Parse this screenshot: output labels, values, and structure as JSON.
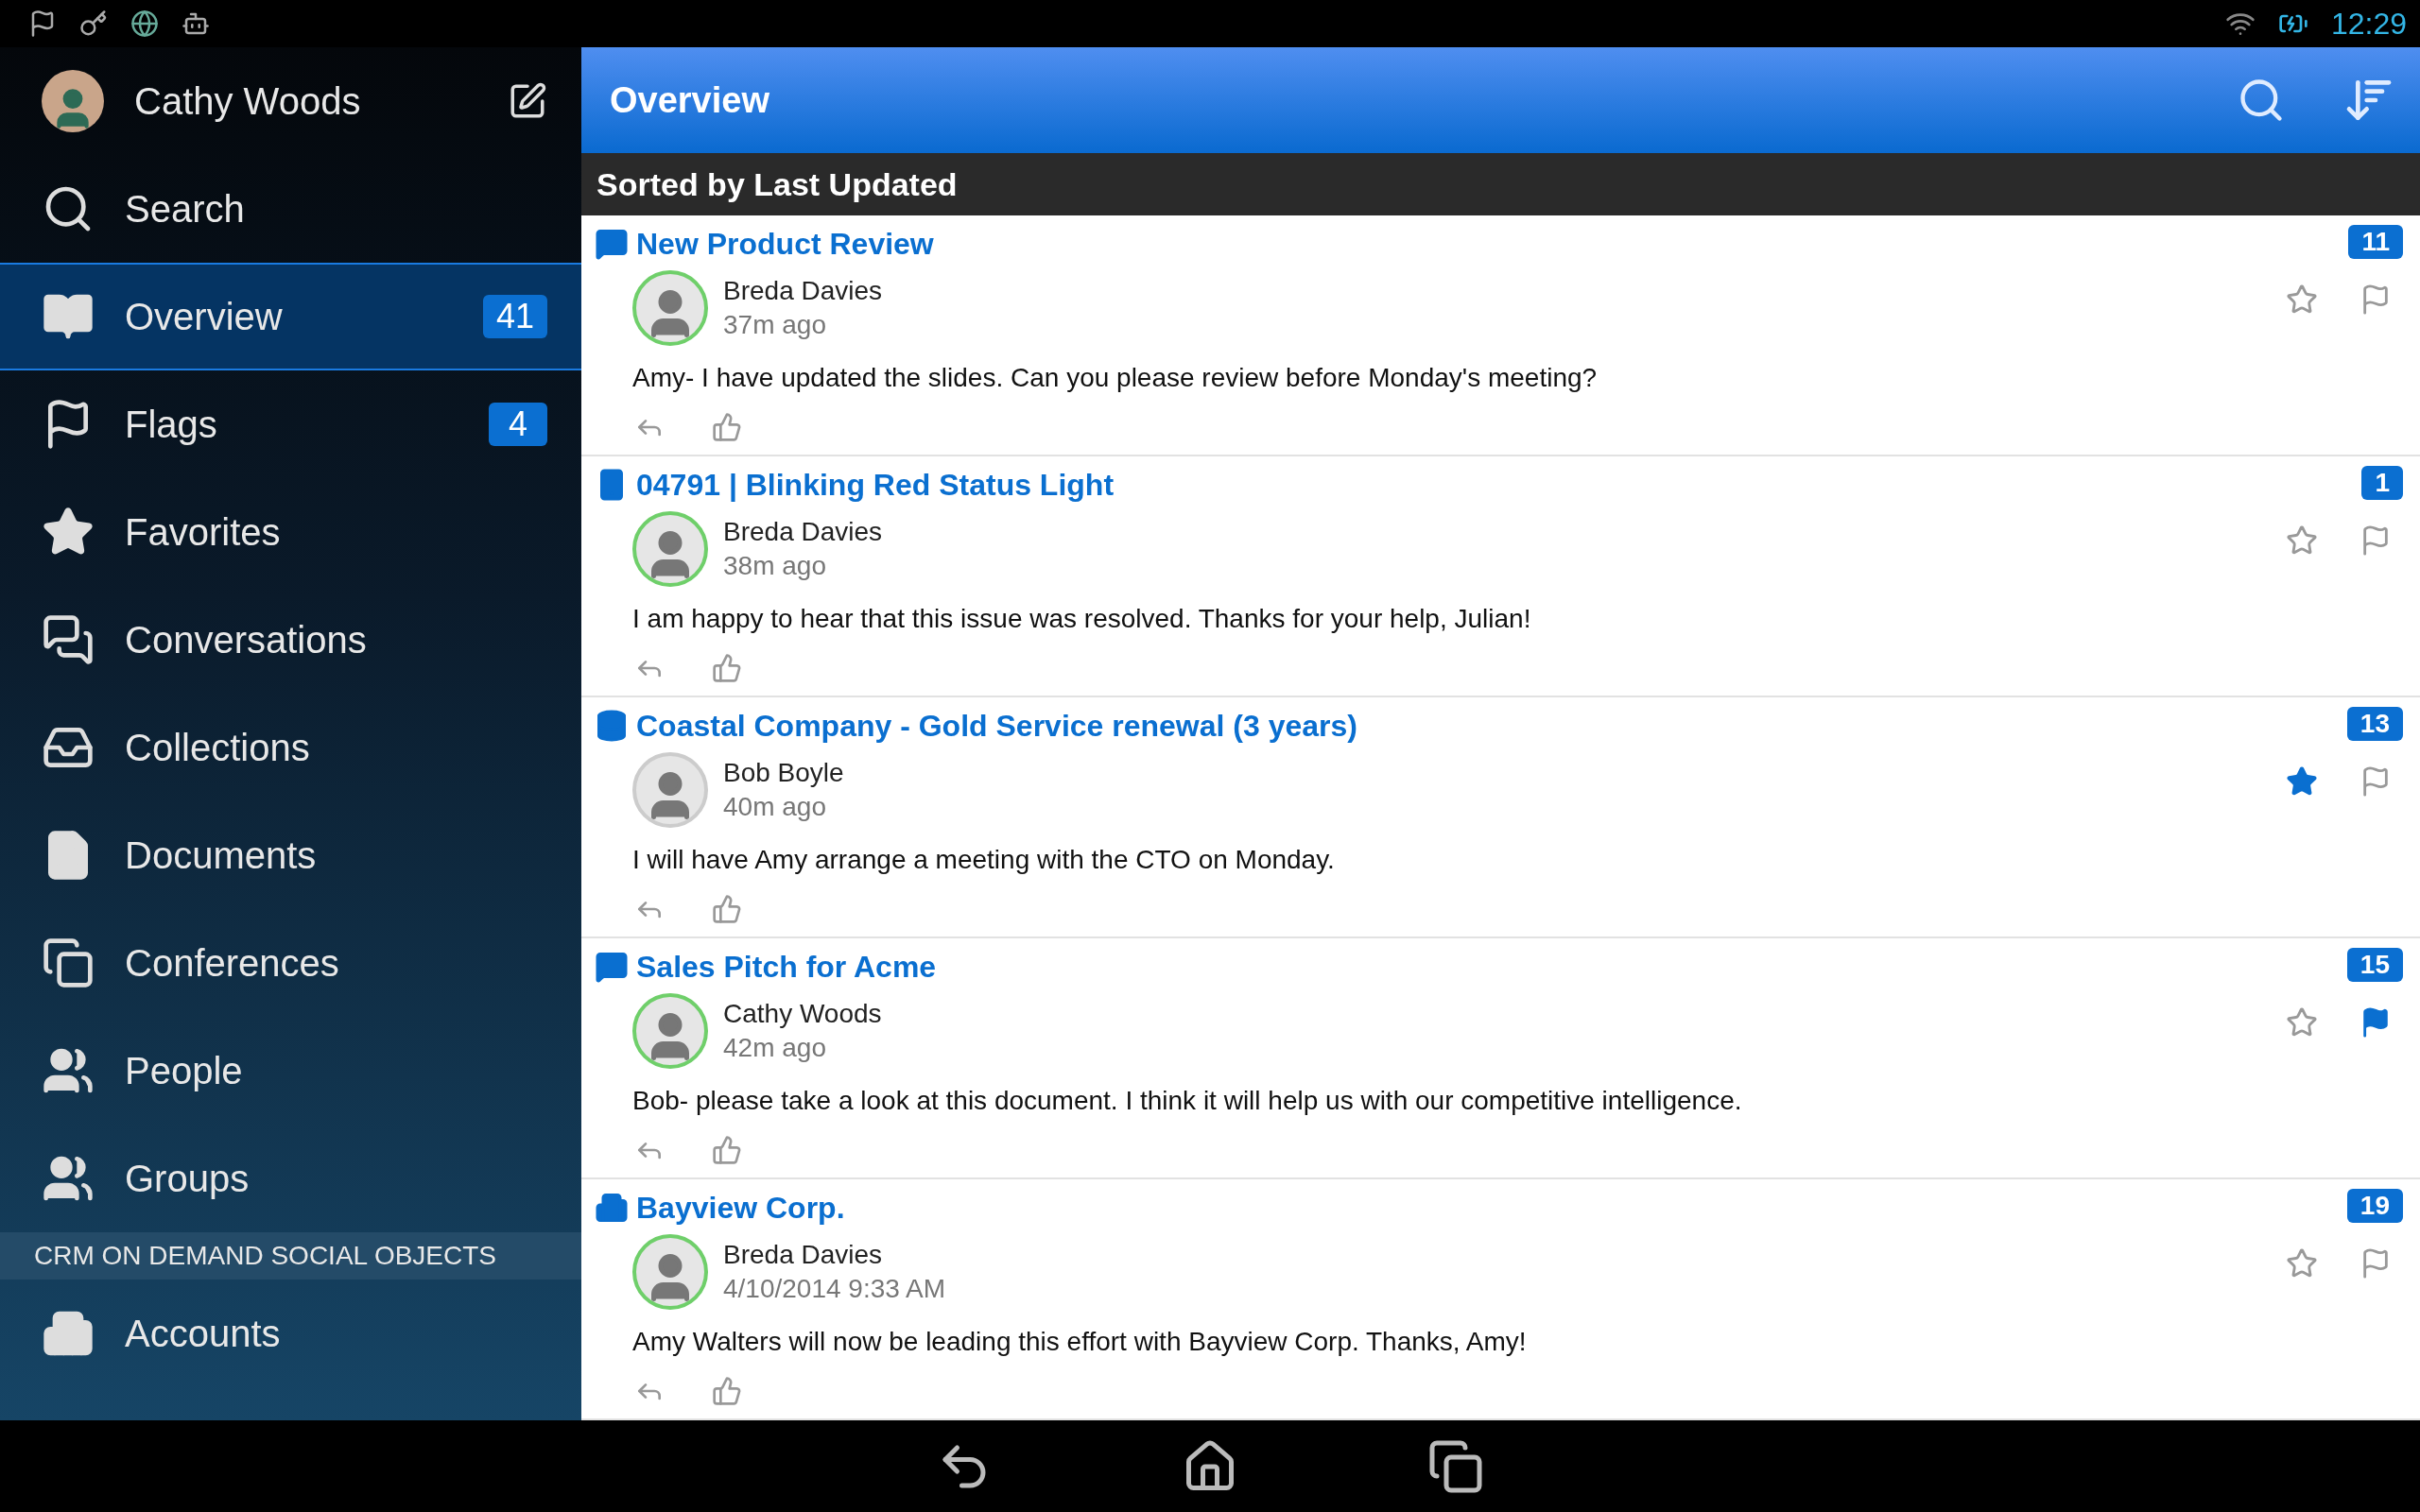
{
  "status_bar": {
    "time": "12:29"
  },
  "sidebar": {
    "user": {
      "name": "Cathy Woods"
    },
    "items": [
      {
        "kind": "search",
        "label": "Search",
        "selected": false
      },
      {
        "kind": "overview",
        "label": "Overview",
        "count": "41",
        "selected": true
      },
      {
        "kind": "flags",
        "label": "Flags",
        "count": "4",
        "selected": false
      },
      {
        "kind": "favorites",
        "label": "Favorites",
        "selected": false
      },
      {
        "kind": "conversations",
        "label": "Conversations",
        "selected": false
      },
      {
        "kind": "collections",
        "label": "Collections",
        "selected": false
      },
      {
        "kind": "documents",
        "label": "Documents",
        "selected": false
      },
      {
        "kind": "conferences",
        "label": "Conferences",
        "selected": false
      },
      {
        "kind": "people",
        "label": "People",
        "selected": false
      },
      {
        "kind": "groups",
        "label": "Groups",
        "selected": false
      }
    ],
    "section": {
      "title": "CRM ON DEMAND SOCIAL OBJECTS",
      "items": [
        {
          "kind": "accounts",
          "label": "Accounts",
          "selected": false
        }
      ]
    }
  },
  "header": {
    "title": "Overview"
  },
  "sort_bar": {
    "label": "Sorted by Last Updated"
  },
  "feed": [
    {
      "kind": "conversation",
      "title": "New Product Review",
      "count": "11",
      "author": "Breda Davies",
      "online": true,
      "time": "37m ago",
      "message": "Amy- I have updated the slides. Can you please review before Monday's meeting?",
      "starred": false,
      "flagged": false
    },
    {
      "kind": "service-request",
      "title": "04791 | Blinking Red Status Light",
      "count": "1",
      "author": "Breda Davies",
      "online": true,
      "time": "38m ago",
      "message": "I am happy to hear that this issue was resolved. Thanks for your help, Julian!",
      "starred": false,
      "flagged": false
    },
    {
      "kind": "opportunity",
      "title": "Coastal Company - Gold Service renewal (3 years)",
      "count": "13",
      "author": "Bob Boyle",
      "online": false,
      "time": "40m ago",
      "message": "I will have Amy arrange a meeting with the CTO on Monday.",
      "starred": true,
      "flagged": false
    },
    {
      "kind": "conversation",
      "title": "Sales Pitch for Acme",
      "count": "15",
      "author": "Cathy Woods",
      "online": true,
      "time": "42m ago",
      "message": "Bob- please take a look at this document. I think it will help us with our competitive intelligence.",
      "starred": false,
      "flagged": true
    },
    {
      "kind": "account",
      "title": "Bayview Corp.",
      "count": "19",
      "author": "Breda Davies",
      "online": true,
      "time": "4/10/2014 9:33 AM",
      "message": "Amy Walters will now be leading this effort with Bayview Corp. Thanks, Amy!",
      "starred": false,
      "flagged": false
    }
  ]
}
